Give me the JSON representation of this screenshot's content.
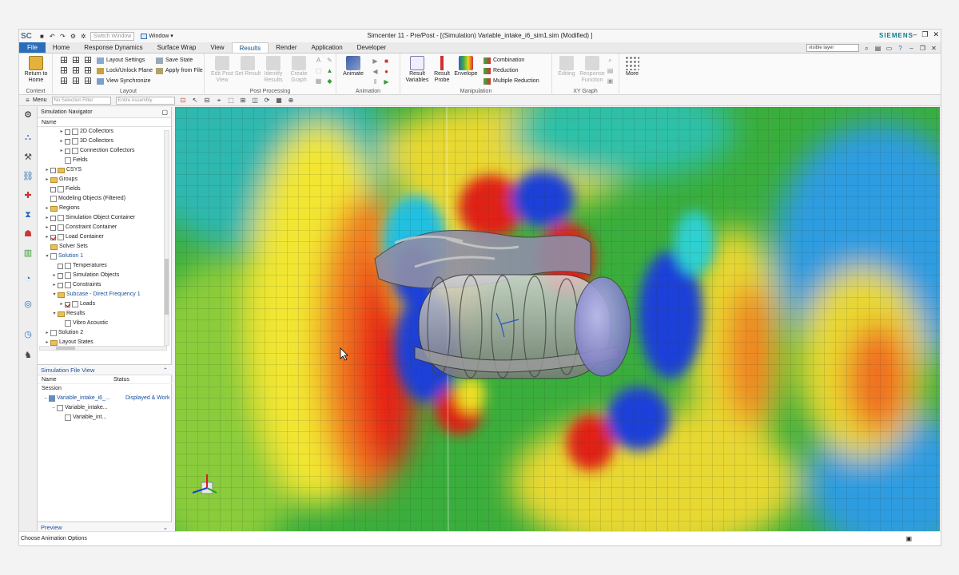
{
  "app": {
    "logo": "SC",
    "window_title": "Simcenter 11 - Pre/Post - [(Simulation) Variable_intake_i6_sim1.sim (Modified) ]",
    "brand": "SIEMENS",
    "window_menu": "Window",
    "window_menu_arrow": "▾",
    "switch_window_placeholder": "Switch Window",
    "win_min": "–",
    "win_restore": "❐",
    "win_close": "✕"
  },
  "tabs": [
    "File",
    "Home",
    "Response Dynamics",
    "Surface Wrap",
    "View",
    "Results",
    "Render",
    "Application",
    "Developer"
  ],
  "active_tab": "Results",
  "search": {
    "value": "visible layer"
  },
  "ribbon": {
    "context": {
      "label": "Context",
      "return_home": "Return to Home"
    },
    "layout": {
      "label": "Layout",
      "items": [
        "Layout Settings",
        "Lock/Unlock Plane",
        "View Synchronize",
        "Save State",
        "Apply from File"
      ]
    },
    "post_processing": {
      "label": "Post Processing",
      "buttons": [
        "Edit Post View",
        "Set Result",
        "Identify Results",
        "Create Graph"
      ]
    },
    "animation": {
      "label": "Animation",
      "animate": "Animate"
    },
    "manipulation": {
      "label": "Manipulation",
      "result_variables": "Result Variables",
      "result_probe": "Result Probe",
      "envelope": "Envelope",
      "combination": "Combination",
      "reduction": "Reduction",
      "multiple_reduction": "Multiple Reduction"
    },
    "xy_graph": {
      "label": "XY Graph",
      "buttons": [
        "Editing",
        "Response Function"
      ]
    },
    "more": "More"
  },
  "toolbar2": {
    "menu": "Menu",
    "selection_filter": "No Selection Filter",
    "assembly": "Entire Assembly"
  },
  "navigator": {
    "title": "Simulation Navigator",
    "column": "Name",
    "items": [
      {
        "label": "2D Collectors",
        "level": 2,
        "cb": true,
        "icon": "mini"
      },
      {
        "label": "3D Collectors",
        "level": 2,
        "cb": true,
        "icon": "mini"
      },
      {
        "label": "Connection Collectors",
        "level": 2,
        "cb": true,
        "icon": "mini"
      },
      {
        "label": "Fields",
        "level": 2,
        "cb": false,
        "icon": "mini",
        "noarrow": true
      },
      {
        "label": "CSYS",
        "level": 0,
        "cb": true,
        "icon": "fold"
      },
      {
        "label": "Groups",
        "level": 0,
        "cb": false,
        "icon": "fold"
      },
      {
        "label": "Fields",
        "level": 0,
        "cb": false,
        "icon": "mini",
        "noarrow": true,
        "cbox": true
      },
      {
        "label": "Modeling Objects (Filtered)",
        "level": 0,
        "cb": false,
        "icon": "mini",
        "noarrow": true
      },
      {
        "label": "Regions",
        "level": 0,
        "cb": false,
        "icon": "fold"
      },
      {
        "label": "Simulation Object Container",
        "level": 0,
        "cb": true,
        "icon": "mini"
      },
      {
        "label": "Constraint Container",
        "level": 0,
        "cb": true,
        "icon": "mini"
      },
      {
        "label": "Load Container",
        "level": 0,
        "cb": true,
        "checked": true,
        "icon": "mini"
      },
      {
        "label": "Solver Sets",
        "level": 0,
        "cb": false,
        "icon": "fold",
        "noarrow": true
      },
      {
        "label": "Solution 1",
        "level": 0,
        "cb": false,
        "icon": "mini",
        "blue": true,
        "open": true
      },
      {
        "label": "Temperatures",
        "level": 1,
        "cb": true,
        "icon": "mini",
        "noarrow": true
      },
      {
        "label": "Simulation Objects",
        "level": 1,
        "cb": true,
        "icon": "mini"
      },
      {
        "label": "Constraints",
        "level": 1,
        "cb": true,
        "icon": "mini"
      },
      {
        "label": "Subcase - Direct Frequency 1",
        "level": 1,
        "cb": false,
        "icon": "fold",
        "blue": true,
        "open": true
      },
      {
        "label": "Loads",
        "level": 2,
        "cb": true,
        "checked": true,
        "icon": "mini"
      },
      {
        "label": "Results",
        "level": 1,
        "cb": false,
        "icon": "fold",
        "open": true
      },
      {
        "label": "Vibro Acoustic",
        "level": 2,
        "cb": false,
        "icon": "mini",
        "noarrow": true
      },
      {
        "label": "Solution 2",
        "level": 0,
        "cb": false,
        "icon": "mini"
      },
      {
        "label": "Layout States",
        "level": 0,
        "cb": false,
        "icon": "fold"
      }
    ]
  },
  "file_view": {
    "title": "Simulation File View",
    "col_name": "Name",
    "col_status": "Status",
    "session": "Session",
    "rows": [
      {
        "name": "Variable_intake_i6_...",
        "status": "Displayed & Work",
        "level": 0
      },
      {
        "name": "Variable_intake...",
        "status": "",
        "level": 1
      },
      {
        "name": "Variable_int...",
        "status": "",
        "level": 2
      }
    ]
  },
  "preview": "Preview",
  "status_bar": "Choose Animation Options",
  "colors": {
    "accent": "#2b6db8",
    "brand": "#0f7a8a"
  }
}
